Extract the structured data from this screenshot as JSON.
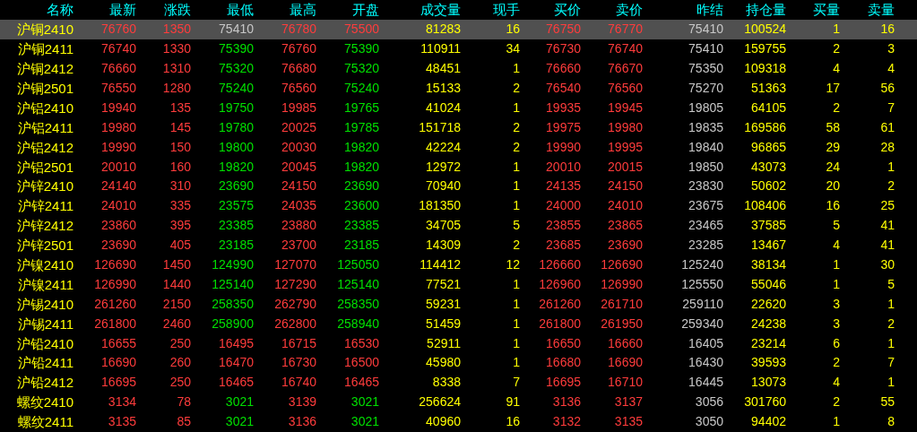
{
  "table": {
    "columns": [
      {
        "label": "名称"
      },
      {
        "label": "最新"
      },
      {
        "label": "涨跌"
      },
      {
        "label": "最低"
      },
      {
        "label": "最高"
      },
      {
        "label": "开盘"
      },
      {
        "label": "成交量"
      },
      {
        "label": "现手"
      },
      {
        "label": "买价"
      },
      {
        "label": "卖价"
      },
      {
        "label": "昨结"
      },
      {
        "label": "持仓量"
      },
      {
        "label": "买量"
      },
      {
        "label": "卖量"
      }
    ],
    "rows": [
      {
        "selected": true,
        "cells": [
          {
            "text": "沪铜2410"
          },
          {
            "text": "76760",
            "kind": "up"
          },
          {
            "text": "1350",
            "kind": "up"
          },
          {
            "text": "75410",
            "kind": "flat"
          },
          {
            "text": "76780",
            "kind": "up"
          },
          {
            "text": "75500",
            "kind": "up"
          },
          {
            "text": "81283"
          },
          {
            "text": "16"
          },
          {
            "text": "76750",
            "kind": "up"
          },
          {
            "text": "76770",
            "kind": "up"
          },
          {
            "text": "75410"
          },
          {
            "text": "100524"
          },
          {
            "text": "1"
          },
          {
            "text": "16"
          }
        ]
      },
      {
        "selected": false,
        "cells": [
          {
            "text": "沪铜2411"
          },
          {
            "text": "76740",
            "kind": "up"
          },
          {
            "text": "1330",
            "kind": "up"
          },
          {
            "text": "75390",
            "kind": "down"
          },
          {
            "text": "76760",
            "kind": "up"
          },
          {
            "text": "75390",
            "kind": "down"
          },
          {
            "text": "110911"
          },
          {
            "text": "34"
          },
          {
            "text": "76730",
            "kind": "up"
          },
          {
            "text": "76740",
            "kind": "up"
          },
          {
            "text": "75410"
          },
          {
            "text": "159755"
          },
          {
            "text": "2"
          },
          {
            "text": "3"
          }
        ]
      },
      {
        "selected": false,
        "cells": [
          {
            "text": "沪铜2412"
          },
          {
            "text": "76660",
            "kind": "up"
          },
          {
            "text": "1310",
            "kind": "up"
          },
          {
            "text": "75320",
            "kind": "down"
          },
          {
            "text": "76680",
            "kind": "up"
          },
          {
            "text": "75320",
            "kind": "down"
          },
          {
            "text": "48451"
          },
          {
            "text": "1"
          },
          {
            "text": "76660",
            "kind": "up"
          },
          {
            "text": "76670",
            "kind": "up"
          },
          {
            "text": "75350"
          },
          {
            "text": "109318"
          },
          {
            "text": "4"
          },
          {
            "text": "4"
          }
        ]
      },
      {
        "selected": false,
        "cells": [
          {
            "text": "沪铜2501"
          },
          {
            "text": "76550",
            "kind": "up"
          },
          {
            "text": "1280",
            "kind": "up"
          },
          {
            "text": "75240",
            "kind": "down"
          },
          {
            "text": "76560",
            "kind": "up"
          },
          {
            "text": "75240",
            "kind": "down"
          },
          {
            "text": "15133"
          },
          {
            "text": "2"
          },
          {
            "text": "76540",
            "kind": "up"
          },
          {
            "text": "76560",
            "kind": "up"
          },
          {
            "text": "75270"
          },
          {
            "text": "51363"
          },
          {
            "text": "17"
          },
          {
            "text": "56"
          }
        ]
      },
      {
        "selected": false,
        "cells": [
          {
            "text": "沪铝2410"
          },
          {
            "text": "19940",
            "kind": "up"
          },
          {
            "text": "135",
            "kind": "up"
          },
          {
            "text": "19750",
            "kind": "down"
          },
          {
            "text": "19985",
            "kind": "up"
          },
          {
            "text": "19765",
            "kind": "down"
          },
          {
            "text": "41024"
          },
          {
            "text": "1"
          },
          {
            "text": "19935",
            "kind": "up"
          },
          {
            "text": "19945",
            "kind": "up"
          },
          {
            "text": "19805"
          },
          {
            "text": "64105"
          },
          {
            "text": "2"
          },
          {
            "text": "7"
          }
        ]
      },
      {
        "selected": false,
        "cells": [
          {
            "text": "沪铝2411"
          },
          {
            "text": "19980",
            "kind": "up"
          },
          {
            "text": "145",
            "kind": "up"
          },
          {
            "text": "19780",
            "kind": "down"
          },
          {
            "text": "20025",
            "kind": "up"
          },
          {
            "text": "19785",
            "kind": "down"
          },
          {
            "text": "151718"
          },
          {
            "text": "2"
          },
          {
            "text": "19975",
            "kind": "up"
          },
          {
            "text": "19980",
            "kind": "up"
          },
          {
            "text": "19835"
          },
          {
            "text": "169586"
          },
          {
            "text": "58"
          },
          {
            "text": "61"
          }
        ]
      },
      {
        "selected": false,
        "cells": [
          {
            "text": "沪铝2412"
          },
          {
            "text": "19990",
            "kind": "up"
          },
          {
            "text": "150",
            "kind": "up"
          },
          {
            "text": "19800",
            "kind": "down"
          },
          {
            "text": "20030",
            "kind": "up"
          },
          {
            "text": "19820",
            "kind": "down"
          },
          {
            "text": "42224"
          },
          {
            "text": "2"
          },
          {
            "text": "19990",
            "kind": "up"
          },
          {
            "text": "19995",
            "kind": "up"
          },
          {
            "text": "19840"
          },
          {
            "text": "96865"
          },
          {
            "text": "29"
          },
          {
            "text": "28"
          }
        ]
      },
      {
        "selected": false,
        "cells": [
          {
            "text": "沪铝2501"
          },
          {
            "text": "20010",
            "kind": "up"
          },
          {
            "text": "160",
            "kind": "up"
          },
          {
            "text": "19820",
            "kind": "down"
          },
          {
            "text": "20045",
            "kind": "up"
          },
          {
            "text": "19820",
            "kind": "down"
          },
          {
            "text": "12972"
          },
          {
            "text": "1"
          },
          {
            "text": "20010",
            "kind": "up"
          },
          {
            "text": "20015",
            "kind": "up"
          },
          {
            "text": "19850"
          },
          {
            "text": "43073"
          },
          {
            "text": "24"
          },
          {
            "text": "1"
          }
        ]
      },
      {
        "selected": false,
        "cells": [
          {
            "text": "沪锌2410"
          },
          {
            "text": "24140",
            "kind": "up"
          },
          {
            "text": "310",
            "kind": "up"
          },
          {
            "text": "23690",
            "kind": "down"
          },
          {
            "text": "24150",
            "kind": "up"
          },
          {
            "text": "23690",
            "kind": "down"
          },
          {
            "text": "70940"
          },
          {
            "text": "1"
          },
          {
            "text": "24135",
            "kind": "up"
          },
          {
            "text": "24150",
            "kind": "up"
          },
          {
            "text": "23830"
          },
          {
            "text": "50602"
          },
          {
            "text": "20"
          },
          {
            "text": "2"
          }
        ]
      },
      {
        "selected": false,
        "cells": [
          {
            "text": "沪锌2411"
          },
          {
            "text": "24010",
            "kind": "up"
          },
          {
            "text": "335",
            "kind": "up"
          },
          {
            "text": "23575",
            "kind": "down"
          },
          {
            "text": "24035",
            "kind": "up"
          },
          {
            "text": "23600",
            "kind": "down"
          },
          {
            "text": "181350"
          },
          {
            "text": "1"
          },
          {
            "text": "24000",
            "kind": "up"
          },
          {
            "text": "24010",
            "kind": "up"
          },
          {
            "text": "23675"
          },
          {
            "text": "108406"
          },
          {
            "text": "16"
          },
          {
            "text": "25"
          }
        ]
      },
      {
        "selected": false,
        "cells": [
          {
            "text": "沪锌2412"
          },
          {
            "text": "23860",
            "kind": "up"
          },
          {
            "text": "395",
            "kind": "up"
          },
          {
            "text": "23385",
            "kind": "down"
          },
          {
            "text": "23880",
            "kind": "up"
          },
          {
            "text": "23385",
            "kind": "down"
          },
          {
            "text": "34705"
          },
          {
            "text": "5"
          },
          {
            "text": "23855",
            "kind": "up"
          },
          {
            "text": "23865",
            "kind": "up"
          },
          {
            "text": "23465"
          },
          {
            "text": "37585"
          },
          {
            "text": "5"
          },
          {
            "text": "41"
          }
        ]
      },
      {
        "selected": false,
        "cells": [
          {
            "text": "沪锌2501"
          },
          {
            "text": "23690",
            "kind": "up"
          },
          {
            "text": "405",
            "kind": "up"
          },
          {
            "text": "23185",
            "kind": "down"
          },
          {
            "text": "23700",
            "kind": "up"
          },
          {
            "text": "23185",
            "kind": "down"
          },
          {
            "text": "14309"
          },
          {
            "text": "2"
          },
          {
            "text": "23685",
            "kind": "up"
          },
          {
            "text": "23690",
            "kind": "up"
          },
          {
            "text": "23285"
          },
          {
            "text": "13467"
          },
          {
            "text": "4"
          },
          {
            "text": "41"
          }
        ]
      },
      {
        "selected": false,
        "cells": [
          {
            "text": "沪镍2410"
          },
          {
            "text": "126690",
            "kind": "up"
          },
          {
            "text": "1450",
            "kind": "up"
          },
          {
            "text": "124990",
            "kind": "down"
          },
          {
            "text": "127070",
            "kind": "up"
          },
          {
            "text": "125050",
            "kind": "down"
          },
          {
            "text": "114412"
          },
          {
            "text": "12"
          },
          {
            "text": "126660",
            "kind": "up"
          },
          {
            "text": "126690",
            "kind": "up"
          },
          {
            "text": "125240"
          },
          {
            "text": "38134"
          },
          {
            "text": "1"
          },
          {
            "text": "30"
          }
        ]
      },
      {
        "selected": false,
        "cells": [
          {
            "text": "沪镍2411"
          },
          {
            "text": "126990",
            "kind": "up"
          },
          {
            "text": "1440",
            "kind": "up"
          },
          {
            "text": "125140",
            "kind": "down"
          },
          {
            "text": "127290",
            "kind": "up"
          },
          {
            "text": "125140",
            "kind": "down"
          },
          {
            "text": "77521"
          },
          {
            "text": "1"
          },
          {
            "text": "126960",
            "kind": "up"
          },
          {
            "text": "126990",
            "kind": "up"
          },
          {
            "text": "125550"
          },
          {
            "text": "55046"
          },
          {
            "text": "1"
          },
          {
            "text": "5"
          }
        ]
      },
      {
        "selected": false,
        "cells": [
          {
            "text": "沪锡2410"
          },
          {
            "text": "261260",
            "kind": "up"
          },
          {
            "text": "2150",
            "kind": "up"
          },
          {
            "text": "258350",
            "kind": "down"
          },
          {
            "text": "262790",
            "kind": "up"
          },
          {
            "text": "258350",
            "kind": "down"
          },
          {
            "text": "59231"
          },
          {
            "text": "1"
          },
          {
            "text": "261260",
            "kind": "up"
          },
          {
            "text": "261710",
            "kind": "up"
          },
          {
            "text": "259110"
          },
          {
            "text": "22620"
          },
          {
            "text": "3"
          },
          {
            "text": "1"
          }
        ]
      },
      {
        "selected": false,
        "cells": [
          {
            "text": "沪锡2411"
          },
          {
            "text": "261800",
            "kind": "up"
          },
          {
            "text": "2460",
            "kind": "up"
          },
          {
            "text": "258900",
            "kind": "down"
          },
          {
            "text": "262800",
            "kind": "up"
          },
          {
            "text": "258940",
            "kind": "down"
          },
          {
            "text": "51459"
          },
          {
            "text": "1"
          },
          {
            "text": "261800",
            "kind": "up"
          },
          {
            "text": "261950",
            "kind": "up"
          },
          {
            "text": "259340"
          },
          {
            "text": "24238"
          },
          {
            "text": "3"
          },
          {
            "text": "2"
          }
        ]
      },
      {
        "selected": false,
        "cells": [
          {
            "text": "沪铅2410"
          },
          {
            "text": "16655",
            "kind": "up"
          },
          {
            "text": "250",
            "kind": "up"
          },
          {
            "text": "16495",
            "kind": "up"
          },
          {
            "text": "16715",
            "kind": "up"
          },
          {
            "text": "16530",
            "kind": "up"
          },
          {
            "text": "52911"
          },
          {
            "text": "1"
          },
          {
            "text": "16650",
            "kind": "up"
          },
          {
            "text": "16660",
            "kind": "up"
          },
          {
            "text": "16405"
          },
          {
            "text": "23214"
          },
          {
            "text": "6"
          },
          {
            "text": "1"
          }
        ]
      },
      {
        "selected": false,
        "cells": [
          {
            "text": "沪铅2411"
          },
          {
            "text": "16690",
            "kind": "up"
          },
          {
            "text": "260",
            "kind": "up"
          },
          {
            "text": "16470",
            "kind": "up"
          },
          {
            "text": "16730",
            "kind": "up"
          },
          {
            "text": "16500",
            "kind": "up"
          },
          {
            "text": "45980"
          },
          {
            "text": "1"
          },
          {
            "text": "16680",
            "kind": "up"
          },
          {
            "text": "16690",
            "kind": "up"
          },
          {
            "text": "16430"
          },
          {
            "text": "39593"
          },
          {
            "text": "2"
          },
          {
            "text": "7"
          }
        ]
      },
      {
        "selected": false,
        "cells": [
          {
            "text": "沪铅2412"
          },
          {
            "text": "16695",
            "kind": "up"
          },
          {
            "text": "250",
            "kind": "up"
          },
          {
            "text": "16465",
            "kind": "up"
          },
          {
            "text": "16740",
            "kind": "up"
          },
          {
            "text": "16465",
            "kind": "up"
          },
          {
            "text": "8338"
          },
          {
            "text": "7"
          },
          {
            "text": "16695",
            "kind": "up"
          },
          {
            "text": "16710",
            "kind": "up"
          },
          {
            "text": "16445"
          },
          {
            "text": "13073"
          },
          {
            "text": "4"
          },
          {
            "text": "1"
          }
        ]
      },
      {
        "selected": false,
        "cells": [
          {
            "text": "螺纹2410"
          },
          {
            "text": "3134",
            "kind": "up"
          },
          {
            "text": "78",
            "kind": "up"
          },
          {
            "text": "3021",
            "kind": "down"
          },
          {
            "text": "3139",
            "kind": "up"
          },
          {
            "text": "3021",
            "kind": "down"
          },
          {
            "text": "256624"
          },
          {
            "text": "91"
          },
          {
            "text": "3136",
            "kind": "up"
          },
          {
            "text": "3137",
            "kind": "up"
          },
          {
            "text": "3056"
          },
          {
            "text": "301760"
          },
          {
            "text": "2"
          },
          {
            "text": "55"
          }
        ]
      },
      {
        "selected": false,
        "cells": [
          {
            "text": "螺纹2411"
          },
          {
            "text": "3135",
            "kind": "up"
          },
          {
            "text": "85",
            "kind": "up"
          },
          {
            "text": "3021",
            "kind": "down"
          },
          {
            "text": "3136",
            "kind": "up"
          },
          {
            "text": "3021",
            "kind": "down"
          },
          {
            "text": "40960"
          },
          {
            "text": "16"
          },
          {
            "text": "3132",
            "kind": "up"
          },
          {
            "text": "3135",
            "kind": "up"
          },
          {
            "text": "3050"
          },
          {
            "text": "94402"
          },
          {
            "text": "1"
          },
          {
            "text": "8"
          }
        ]
      }
    ]
  }
}
